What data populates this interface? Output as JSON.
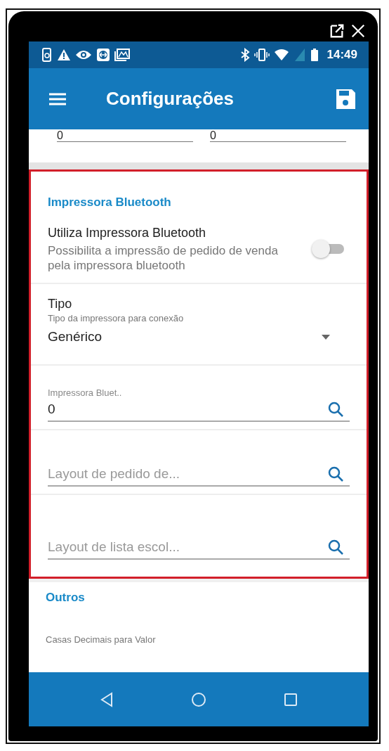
{
  "status_bar": {
    "time": "14:49"
  },
  "app_bar": {
    "title": "Configurações"
  },
  "top_fields": [
    {
      "value": "0"
    },
    {
      "value": "0"
    }
  ],
  "sections": [
    {
      "title": "Impressora Bluetooth",
      "highlighted": true,
      "items": [
        {
          "kind": "switch",
          "label": "Utiliza Impressora Bluetooth",
          "description": "Possibilita a impressão de pedido de venda pela impressora bluetooth",
          "on": false
        },
        {
          "kind": "dropdown",
          "label": "Tipo",
          "description": "Tipo da impressora para conexão",
          "value": "Genérico"
        },
        {
          "kind": "lookup",
          "label": "Impressora Bluet..",
          "value": "0"
        },
        {
          "kind": "lookup",
          "placeholder": "Layout de pedido de..."
        },
        {
          "kind": "lookup",
          "placeholder": "Layout de lista escol..."
        }
      ]
    },
    {
      "title": "Outros",
      "highlighted": false,
      "items": [
        {
          "kind": "caption",
          "label": "Casas Decimais para Valor"
        }
      ]
    }
  ]
}
